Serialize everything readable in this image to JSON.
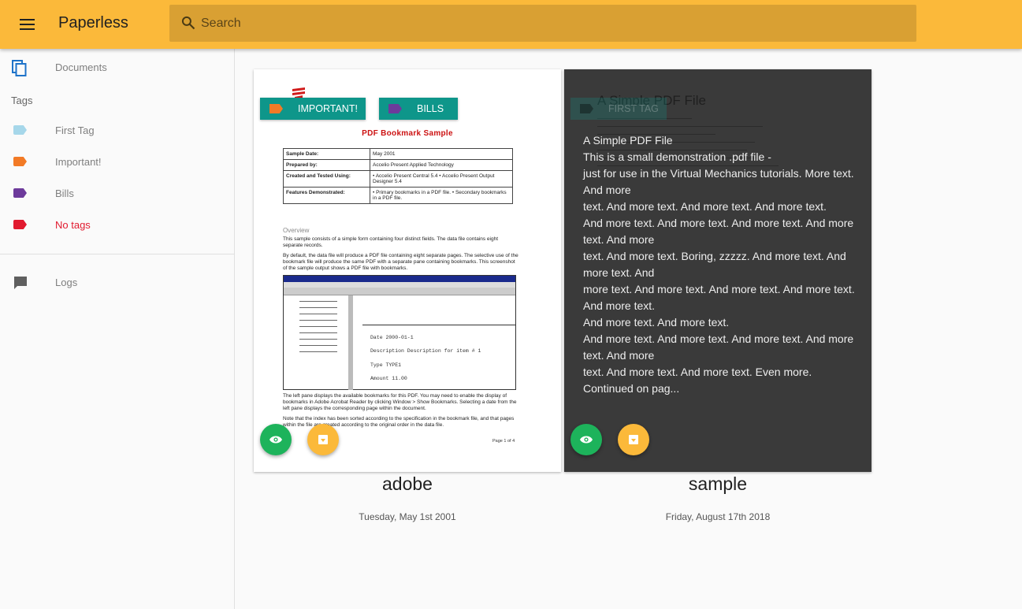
{
  "app": {
    "title": "Paperless"
  },
  "search": {
    "placeholder": "Search"
  },
  "sidebar": {
    "documents_label": "Documents",
    "tags_heading": "Tags",
    "tags": [
      {
        "label": "First Tag",
        "color": "#a6d7ea"
      },
      {
        "label": "Important!",
        "color": "#f27a26"
      },
      {
        "label": "Bills",
        "color": "#6d3a9b"
      },
      {
        "label": "No tags",
        "color": "#e11a2f"
      }
    ],
    "logs_label": "Logs"
  },
  "documents": [
    {
      "title": "adobe",
      "date": "Tuesday, May 1st 2001",
      "tags": [
        {
          "label": "IMPORTANT!",
          "color": "#f27a26"
        },
        {
          "label": "BILLS",
          "color": "#6d3a9b"
        }
      ],
      "thumbnail": {
        "heading": "PDF Bookmark Sample",
        "rows": [
          {
            "key": "Sample Date:",
            "value": "May 2001"
          },
          {
            "key": "Prepared by:",
            "value": "Accelio Present Applied Technology"
          },
          {
            "key": "Created and Tested Using:",
            "value": "• Accelio Present Central 5.4  • Accelio Present Output Designer 5.4"
          },
          {
            "key": "Features Demonstrated:",
            "value": "• Primary bookmarks in a PDF file.  • Secondary bookmarks in a PDF file."
          }
        ],
        "section": "Overview",
        "para1": "This sample consists of a simple form containing four distinct fields. The data file contains eight separate records.",
        "para2": "By default, the data file will produce a PDF file containing eight separate pages. The selective use of the bookmark file will produce the same PDF with a separate pane containing bookmarks. This screenshot of the sample output shows a PDF file with bookmarks.",
        "shot_date": "Date          2000-01-1",
        "shot_desc": "Description   Description for item # 1",
        "shot_type": "Type          TYPE1",
        "shot_amount": "Amount            11.00",
        "para3": "The left pane displays the available bookmarks for this PDF. You may need to enable the display of bookmarks in Adobe Acrobat Reader by clicking Window > Show Bookmarks. Selecting a date from the left pane displays the corresponding page within the document.",
        "para4": "Note that the index has been sorted according to the specification in the bookmark file, and that pages within the file are created according to the original order in the data file.",
        "page_no": "Page 1 of 4"
      }
    },
    {
      "title": "sample",
      "date": "Friday, August 17th 2018",
      "tags": [
        {
          "label": "FIRST TAG",
          "color": "#a6d7ea"
        }
      ],
      "faint_title": "A Simple PDF File",
      "content": "A Simple PDF File\nThis is a small demonstration .pdf file -\njust for use in the Virtual Mechanics tutorials. More text. And more\ntext. And more text. And more text. And more text.\nAnd more text. And more text. And more text. And more text. And more\ntext. And more text. Boring, zzzzz. And more text. And more text. And\nmore text. And more text. And more text. And more text. And more text.\nAnd more text. And more text.\nAnd more text. And more text. And more text. And more text. And more\ntext. And more text. And more text. Even more. Continued on pag..."
    }
  ]
}
